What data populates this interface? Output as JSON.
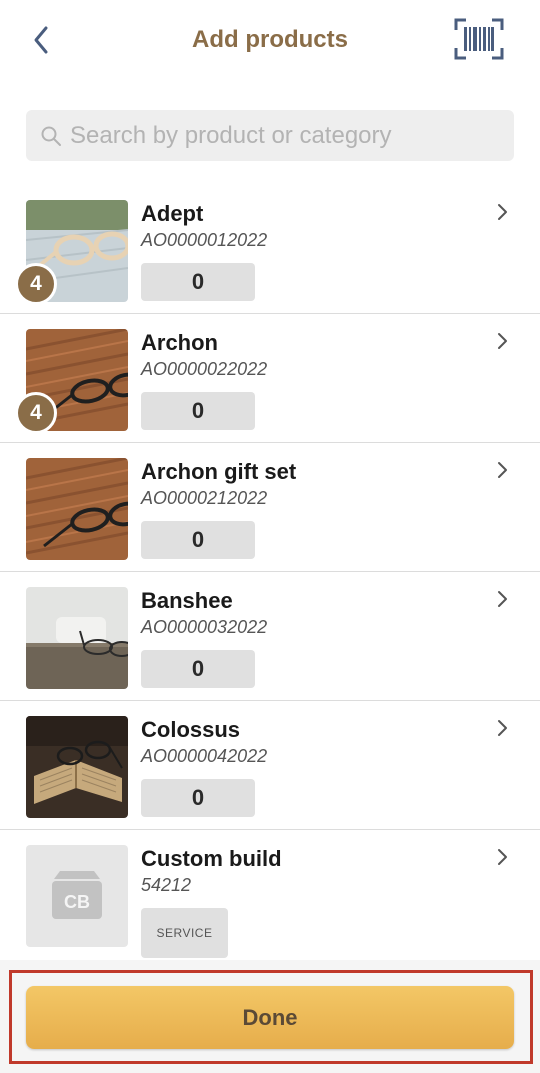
{
  "header": {
    "title": "Add products",
    "back_icon": "chevron-left-icon",
    "scan_icon": "barcode-scan-icon"
  },
  "search": {
    "placeholder": "Search by product or category",
    "value": "",
    "icon": "search-icon"
  },
  "products": [
    {
      "name": "Adept",
      "sku": "AO0000012022",
      "quantity": "0",
      "badge": "4",
      "image": "sunglasses-on-deck-photo"
    },
    {
      "name": "Archon",
      "sku": "AO0000022022",
      "quantity": "0",
      "badge": "4",
      "image": "glasses-on-wood-photo"
    },
    {
      "name": "Archon gift set",
      "sku": "AO0000212022",
      "quantity": "0",
      "image": "glasses-on-wood-photo"
    },
    {
      "name": "Banshee",
      "sku": "AO0000032022",
      "quantity": "0",
      "image": "glasses-on-table-photo"
    },
    {
      "name": "Colossus",
      "sku": "AO0000042022",
      "quantity": "0",
      "image": "glasses-on-book-photo"
    },
    {
      "name": "Custom build",
      "sku": "54212",
      "tag": "SERVICE",
      "placeholder_initials": "CB",
      "image": "box-placeholder-icon"
    }
  ],
  "footer": {
    "done_label": "Done"
  },
  "colors": {
    "accent": "#8a6d48",
    "done_button": "#eeb955",
    "highlight_frame": "#c0392b"
  }
}
